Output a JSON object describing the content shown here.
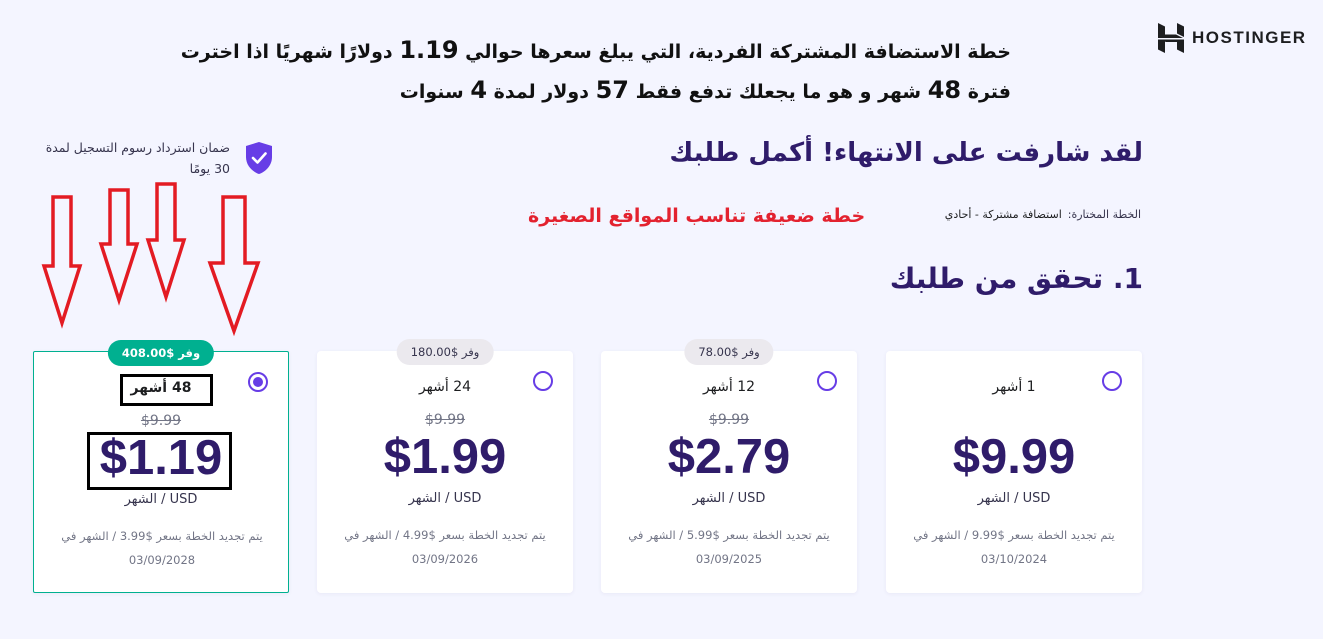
{
  "brand": {
    "name": "HOSTINGER"
  },
  "note": {
    "line1_pre": "خطة الاستضافة المشتركة الفردية، التي يبلغ سعرها حوالي ",
    "line1_num": "1.19",
    "line1_post": " دولارًا شهريًا اذا اخترت",
    "line2_a": "فترة ",
    "line2_num1": "48",
    "line2_b": " شهر و هو ما يجعلك تدفع فقط ",
    "line2_num2": "57",
    "line2_c": " دولار لمدة ",
    "line2_num3": "4",
    "line2_d": " سنوات"
  },
  "page": {
    "title": "لقد شارفت على الانتهاء! أكمل طلبك"
  },
  "plan": {
    "label": "الخطة المختارة:",
    "value": "استضافة مشتركة - أحادي",
    "warning": "خطة ضعيفة  تناسب المواقع الصغيرة"
  },
  "step": {
    "title": "1. تحقق من طلبك"
  },
  "guarantee": {
    "text": "ضمان استرداد رسوم التسجيل لمدة 30 يومًا"
  },
  "cards": [
    {
      "badge": "وفر $408.00",
      "duration": "48 أشهر",
      "old_price": "$9.99",
      "price": "$1.19",
      "unit": "USD / الشهر",
      "renew": "يتم تجديد الخطة بسعر $3.99 / الشهر في",
      "renew_date": "03/09/2028",
      "selected": true
    },
    {
      "badge": "وفر $180.00",
      "duration": "24 أشهر",
      "old_price": "$9.99",
      "price": "$1.99",
      "unit": "USD / الشهر",
      "renew": "يتم تجديد الخطة بسعر $4.99 / الشهر في",
      "renew_date": "03/09/2026",
      "selected": false
    },
    {
      "badge": "وفر $78.00",
      "duration": "12 أشهر",
      "old_price": "$9.99",
      "price": "$2.79",
      "unit": "USD / الشهر",
      "renew": "يتم تجديد الخطة بسعر $5.99 / الشهر في",
      "renew_date": "03/09/2025",
      "selected": false
    },
    {
      "badge": "",
      "duration": "1 أشهر",
      "old_price": "",
      "price": "$9.99",
      "unit": "USD / الشهر",
      "renew": "يتم تجديد الخطة بسعر $9.99 / الشهر في",
      "renew_date": "03/10/2024",
      "selected": false
    }
  ],
  "colors": {
    "accent": "#673de6",
    "selected_border": "#00b090",
    "warning": "#e3222f",
    "price": "#2f1c6a",
    "annotation_arrow": "#e31b23"
  },
  "icons": {
    "logo": "hostinger-logo-icon",
    "guarantee": "shield-check-icon",
    "radio": "radio-icon",
    "annotation": "down-arrow-icon"
  }
}
